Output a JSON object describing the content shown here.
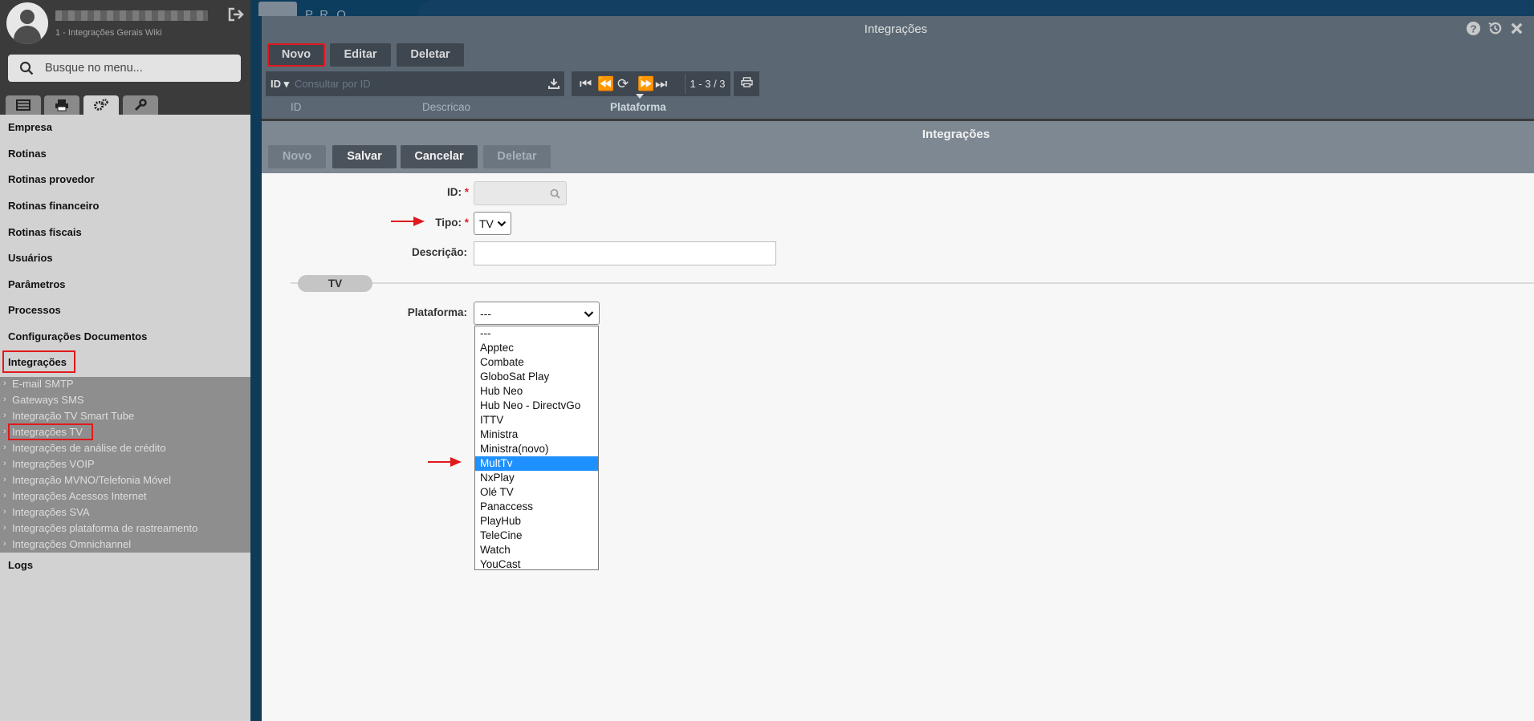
{
  "sidebar": {
    "user_subtitle": "1 - Integrações Gerais Wiki",
    "search_placeholder": "Busque no menu...",
    "menu": [
      "Empresa",
      "Rotinas",
      "Rotinas provedor",
      "Rotinas financeiro",
      "Rotinas fiscais",
      "Usuários",
      "Parâmetros",
      "Processos",
      "Configurações Documentos",
      "Integrações"
    ],
    "submenu": [
      "E-mail SMTP",
      "Gateways SMS",
      "Integração TV Smart Tube",
      "Integrações TV",
      "Integrações de análise de crédito",
      "Integrações VOIP",
      "Integração MVNO/Telefonia Móvel",
      "Integrações Acessos Internet",
      "Integrações SVA",
      "Integrações plataforma de rastreamento",
      "Integrações Omnichannel"
    ],
    "logs": "Logs"
  },
  "bg_window": {
    "title": "P.R.O."
  },
  "list_window": {
    "title": "Integrações",
    "buttons": {
      "novo": "Novo",
      "editar": "Editar",
      "deletar": "Deletar"
    },
    "filter": {
      "field": "ID ▾",
      "placeholder": "Consultar por ID"
    },
    "pager_count": "1 - 3 / 3",
    "columns": [
      "ID",
      "Descricao",
      "Plataforma"
    ]
  },
  "form_window": {
    "title": "Integrações",
    "buttons": {
      "novo": "Novo",
      "salvar": "Salvar",
      "cancelar": "Cancelar",
      "deletar": "Deletar"
    },
    "labels": {
      "id": "ID:",
      "tipo": "Tipo:",
      "descricao": "Descrição:",
      "plataforma": "Plataforma:",
      "required": "*"
    },
    "tipo_value": "TV",
    "section": "TV",
    "plataforma_value": "---",
    "plataforma_options": [
      "---",
      "Apptec",
      "Combate",
      "GloboSat Play",
      "Hub Neo",
      "Hub Neo - DirectvGo",
      "ITTV",
      "Ministra",
      "Ministra(novo)",
      "MultTv",
      "NxPlay",
      "Olé TV",
      "Panaccess",
      "PlayHub",
      "TeleCine",
      "Watch",
      "YouCast"
    ],
    "plataforma_highlighted": "MultTv"
  },
  "colors": {
    "highlight_box": "#e0191c",
    "annotation_arrow": "#e0191c",
    "selected_option": "#1e90ff"
  }
}
